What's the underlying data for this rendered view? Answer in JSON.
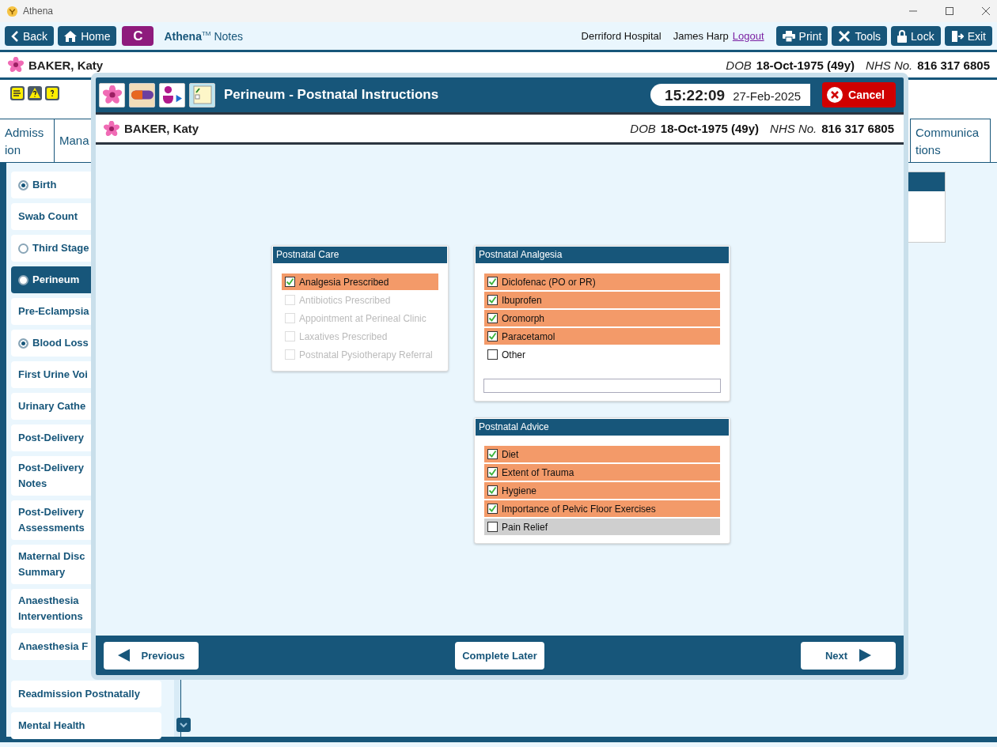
{
  "window": {
    "title": "Athena"
  },
  "toolbar": {
    "buttons": [
      {
        "label": "Back"
      },
      {
        "label": "Home"
      },
      {
        "label": "C"
      }
    ],
    "app_name": "Athena",
    "app_mark": "TM",
    "app_section": "Notes",
    "hospital": "Derriford Hospital",
    "user": "James Harp",
    "logout": "Logout",
    "right_buttons": [
      {
        "label": "Print"
      },
      {
        "label": "Tools"
      },
      {
        "label": "Lock"
      },
      {
        "label": "Exit"
      }
    ]
  },
  "patient": {
    "name": "BAKER, Katy",
    "dob_label": "DOB",
    "dob": "18-Oct-1975 (49y)",
    "nhs_label": "NHS No.",
    "nhs": "816 317 6805"
  },
  "tabs": [
    {
      "label": "Admiss ion",
      "selected": false
    },
    {
      "label": "Mana",
      "selected": false
    },
    {
      "label": "Communica tions",
      "selected": false
    }
  ],
  "sidebar": {
    "sections": [
      [
        {
          "label": "Birth",
          "kind": "radio",
          "checked": true,
          "selected": false
        },
        {
          "label": "Swab Count",
          "kind": "plain",
          "selected": false
        },
        {
          "label": "Third Stage",
          "kind": "radio",
          "checked": false,
          "selected": false
        },
        {
          "label": "Perineum",
          "kind": "radio",
          "checked": false,
          "selected": true
        },
        {
          "label": "Pre-Eclampsia",
          "kind": "plain",
          "selected": false
        },
        {
          "label": "Blood Loss",
          "kind": "radio",
          "checked": true,
          "selected": false
        },
        {
          "label": "First Urine Voi",
          "kind": "plain",
          "selected": false
        },
        {
          "label": "Urinary Cathe",
          "kind": "plain",
          "selected": false
        },
        {
          "label": "Post-Delivery",
          "kind": "plain",
          "selected": false
        },
        {
          "label": "Post-Delivery Notes",
          "kind": "plain",
          "selected": false
        },
        {
          "label": "Post-Delivery Assessments",
          "kind": "plain",
          "selected": false
        },
        {
          "label": "Maternal Disc Summary",
          "kind": "plain",
          "selected": false
        },
        {
          "label": "Anaesthesia Interventions",
          "kind": "plain",
          "selected": false
        },
        {
          "label": "Anaesthesia F",
          "kind": "plain",
          "selected": false
        }
      ],
      [
        {
          "label": "Readmission Postnatally",
          "kind": "plain",
          "selected": false
        },
        {
          "label": "Mental Health",
          "kind": "plain",
          "selected": false
        }
      ]
    ]
  },
  "dialog": {
    "title": "Perineum - Postnatal Instructions",
    "time": "15:22:09",
    "date": "27-Feb-2025",
    "cancel": "Cancel",
    "patient": {
      "name": "BAKER, Katy",
      "dob_label": "DOB",
      "dob": "18-Oct-1975 (49y)",
      "nhs_label": "NHS No.",
      "nhs": "816 317 6805"
    },
    "columns": [
      [
        {
          "title": "Postnatal Care",
          "items": [
            {
              "label": "Analgesia Prescribed",
              "checked": true,
              "disabled": false
            },
            {
              "label": "Antibiotics Prescribed",
              "checked": false,
              "disabled": true
            },
            {
              "label": "Appointment at Perineal Clinic",
              "checked": false,
              "disabled": true
            },
            {
              "label": "Laxatives Prescribed",
              "checked": false,
              "disabled": true
            },
            {
              "label": "Postnatal Pysiotherapy Referral",
              "checked": false,
              "disabled": true
            }
          ],
          "other_field": false
        }
      ],
      [
        {
          "title": "Postnatal Analgesia",
          "items": [
            {
              "label": "Diclofenac (PO or PR)",
              "checked": true,
              "disabled": false
            },
            {
              "label": "Ibuprofen",
              "checked": true,
              "disabled": false
            },
            {
              "label": "Oromorph",
              "checked": true,
              "disabled": false
            },
            {
              "label": "Paracetamol",
              "checked": true,
              "disabled": false
            },
            {
              "label": "Other",
              "checked": false,
              "disabled": false
            }
          ],
          "other_field": true
        },
        {
          "title": "Postnatal Advice",
          "items": [
            {
              "label": "Diet",
              "checked": true,
              "disabled": false,
              "focused": false
            },
            {
              "label": "Extent of Trauma",
              "checked": true,
              "disabled": false,
              "focused": false
            },
            {
              "label": "Hygiene",
              "checked": true,
              "disabled": false,
              "focused": false
            },
            {
              "label": "Importance of Pelvic Floor Exercises",
              "checked": true,
              "disabled": false,
              "focused": false
            },
            {
              "label": "Pain Relief",
              "checked": false,
              "disabled": false,
              "focused": true
            }
          ],
          "other_field": false
        }
      ]
    ],
    "footer": {
      "previous": "Previous",
      "later": "Complete Later",
      "next": "Next"
    }
  }
}
